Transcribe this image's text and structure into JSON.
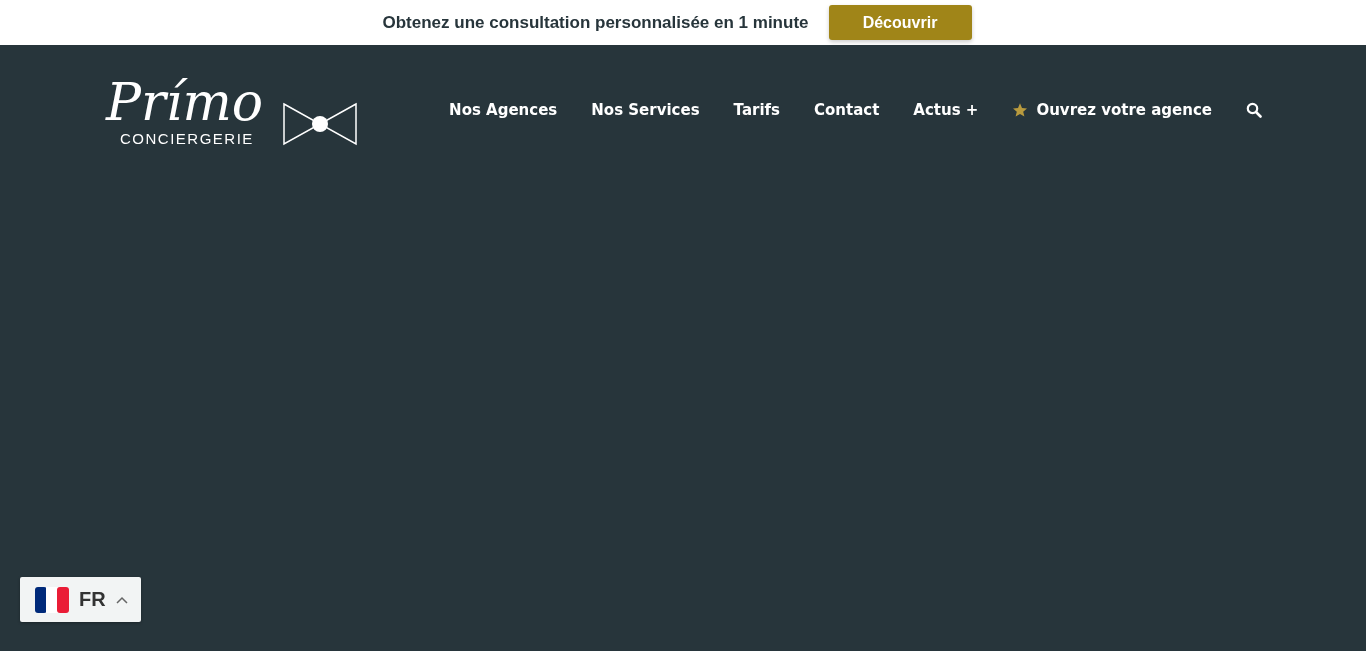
{
  "promo_bar": {
    "text": "Obtenez une consultation personnalisée en 1 minute",
    "button": "Découvrir"
  },
  "logo": {
    "name": "Prímo",
    "tagline": "CONCIERGERIE"
  },
  "nav": [
    {
      "label": "Nos Agences",
      "kind": "link"
    },
    {
      "label": "Nos Services",
      "kind": "link"
    },
    {
      "label": "Tarifs",
      "kind": "link"
    },
    {
      "label": "Contact",
      "kind": "link"
    },
    {
      "label": "Actus +",
      "kind": "link"
    },
    {
      "label": "Ouvrez votre agence",
      "kind": "starred"
    }
  ],
  "language_switcher": {
    "code": "FR"
  }
}
